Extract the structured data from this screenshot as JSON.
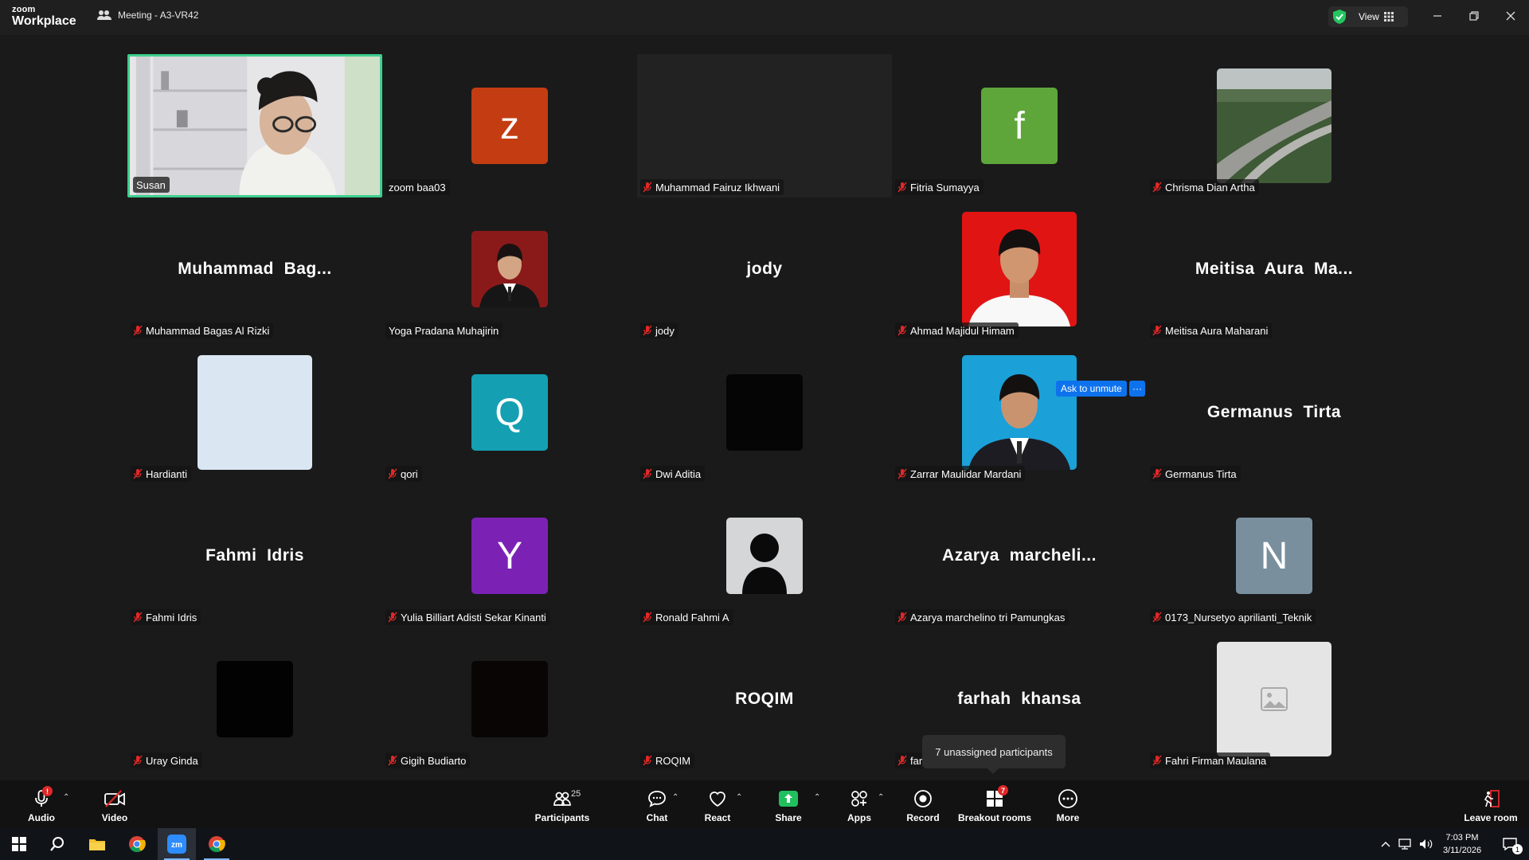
{
  "app": {
    "logo_top": "zoom",
    "logo_bottom": "Workplace",
    "meeting_title": "Meeting - A3-VR42",
    "view_label": "View"
  },
  "tiles": [
    {
      "name": "Susan",
      "type": "video",
      "muted": false,
      "active": true
    },
    {
      "name": "zoom baa03",
      "type": "letter",
      "letter": "z",
      "color": "#c43d12",
      "muted": false
    },
    {
      "name": "Muhammad Fairuz Ikhwani",
      "type": "blank",
      "muted": true
    },
    {
      "name": "Fitria Sumayya",
      "type": "letter",
      "letter": "f",
      "color": "#5ea63a",
      "muted": true
    },
    {
      "name": "Chrisma Dian Artha",
      "type": "photo-landscape",
      "muted": true
    },
    {
      "name": "Muhammad Bagas Al Rizki",
      "type": "text",
      "display": "Muhammad  Bag...",
      "muted": true
    },
    {
      "name": "Yoga Pradana Muhajirin",
      "type": "photo-red-small",
      "muted": false
    },
    {
      "name": "jody",
      "type": "text",
      "display": "jody",
      "muted": true
    },
    {
      "name": "Ahmad Majidul Himam",
      "type": "photo-red",
      "muted": true
    },
    {
      "name": "Meitisa Aura Maharani",
      "type": "text",
      "display": "Meitisa  Aura  Ma...",
      "muted": true
    },
    {
      "name": "Hardianti",
      "type": "pale",
      "muted": true
    },
    {
      "name": "qori",
      "type": "letter",
      "letter": "Q",
      "color": "#14a0b2",
      "muted": true
    },
    {
      "name": "Dwi Aditia",
      "type": "dark",
      "muted": true
    },
    {
      "name": "Zarrar Maulidar Mardani",
      "type": "photo-blue",
      "muted": true
    },
    {
      "name": "Germanus Tirta",
      "type": "text",
      "display": "Germanus  Tirta",
      "muted": true
    },
    {
      "name": "Fahmi Idris",
      "type": "text",
      "display": "Fahmi  Idris",
      "muted": true
    },
    {
      "name": "Yulia Billiart Adisti Sekar Kinanti",
      "type": "letter",
      "letter": "Y",
      "color": "#7b22b5",
      "muted": true
    },
    {
      "name": "Ronald Fahmi A",
      "type": "silhouette",
      "muted": true
    },
    {
      "name": "Azarya marchelino tri Pamungkas",
      "type": "text",
      "display": "Azarya  marcheli...",
      "muted": true
    },
    {
      "name": "0173_Nursetyo aprilianti_Teknik",
      "type": "letter",
      "letter": "N",
      "color": "#7a8f9e",
      "muted": true
    },
    {
      "name": "Uray Ginda",
      "type": "dark",
      "muted": true
    },
    {
      "name": "Gigih Budiarto",
      "type": "dark",
      "muted": true
    },
    {
      "name": "ROQIM",
      "type": "text",
      "display": "ROQIM",
      "muted": true
    },
    {
      "name": "far",
      "type": "text",
      "display": "farhah  khansa",
      "muted": true
    },
    {
      "name": "Fahri Firman Maulana",
      "type": "image-placeholder",
      "muted": true
    }
  ],
  "ask_to_unmute": {
    "label": "Ask to unmute",
    "more": "···"
  },
  "tooltip": "7 unassigned participants",
  "toolbar": {
    "audio": "Audio",
    "audio_badge": "!",
    "video": "Video",
    "participants": "Participants",
    "participants_count": "25",
    "chat": "Chat",
    "react": "React",
    "share": "Share",
    "apps": "Apps",
    "record": "Record",
    "breakout": "Breakout rooms",
    "breakout_badge": "7",
    "more": "More",
    "leave": "Leave room"
  },
  "taskbar": {
    "time": "7:03 PM",
    "date": "3/11/2026",
    "notification_count": "1"
  },
  "colors": {
    "accent_green": "#3ecf8e",
    "zoom_blue": "#0e72ed",
    "share_green": "#21c05e",
    "badge_red": "#e02828"
  }
}
